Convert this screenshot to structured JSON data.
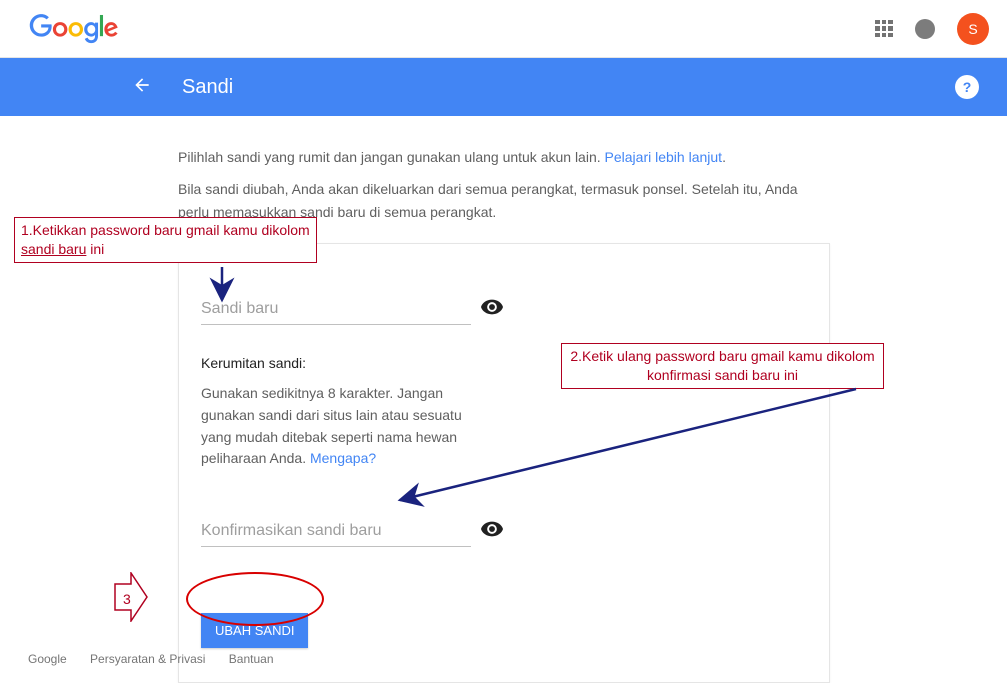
{
  "header": {
    "avatar_letter": "S"
  },
  "bluebar": {
    "title": "Sandi"
  },
  "intro": {
    "line1_a": "Pilihlah sandi yang rumit dan jangan gunakan ulang untuk akun lain. ",
    "learn_more": "Pelajari lebih lanjut",
    "line1_b": ".",
    "line2": "Bila sandi diubah, Anda akan dikeluarkan dari semua perangkat, termasuk ponsel. Setelah itu, Anda perlu memasukkan sandi baru di semua perangkat."
  },
  "form": {
    "new_password_placeholder": "Sandi baru",
    "strength_label": "Kerumitan sandi:",
    "strength_desc_a": "Gunakan sedikitnya 8 karakter. Jangan gunakan sandi dari situs lain atau sesuatu yang mudah ditebak seperti nama hewan peliharaan Anda. ",
    "why_link": "Mengapa?",
    "confirm_placeholder": "Konfirmasikan sandi baru",
    "change_button": "UBAH SANDI"
  },
  "footer": {
    "google": "Google",
    "terms": "Persyaratan & Privasi",
    "help": "Bantuan"
  },
  "annotations": {
    "a1_pre": "1.Ketikkan password baru gmail kamu dikolom ",
    "a1_u": "sandi baru",
    "a1_post": " ini",
    "a2": "2.Ketik ulang password baru gmail kamu dikolom konfirmasi sandi baru ini",
    "a3": "3"
  }
}
